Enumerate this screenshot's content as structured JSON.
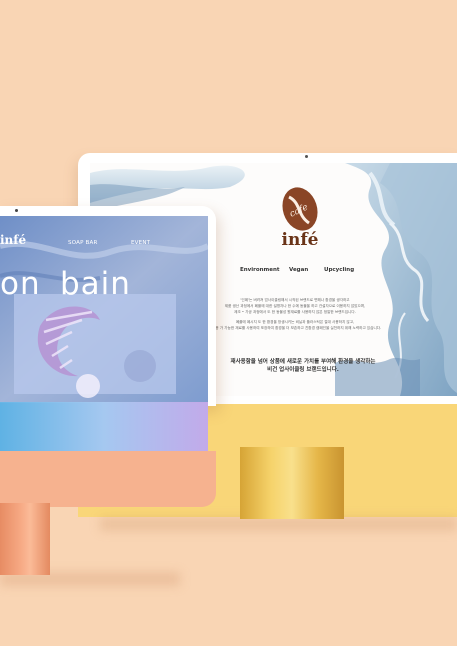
{
  "colors": {
    "background": "#f9d5b4",
    "back_chin": "#f9d678",
    "front_chin": "#f6b28f",
    "brand_brown": "#6a3418"
  },
  "back_site": {
    "logo_icon": "coffee-bean-logo-icon",
    "logo_text": "cafe",
    "brand_name": "infé",
    "nav": [
      "Environment",
      "Vegan",
      "Upcycling"
    ],
    "intro_lines": [
      "'인페'는 버려져 업사이클링해서 시작된 브랜드로 변해나 환경을 생각하고",
      "제품 생산 과정에서 폐플에 대한 설명자나 한 수에 동물을 하고 건설자으로 이용하지 않았으며,",
      "제조 • 가공 과정에서 도 한 동물성 원재료를 사용하지 않은 정말한 브랜드입니다.",
      "",
      "폐플에 페시지 도 한 환경을 망생시키는 비닐과 플라스틱은 절대 사용하지 않고,",
      "재활용 가 가능한 재료를 사용하여 포장하여 환경을 더 보존하고 친환경 캠페인을 실천하지 위해 노력하고 있습니다."
    ],
    "slogan_lines": [
      "재사용함을 넘어 상품에 새로운 가치를 부여해 환경을 생각하는",
      "비건 업사이클링 브랜드입니다."
    ]
  },
  "front_site": {
    "logo": "infé",
    "nav": [
      "SOAP BAR",
      "EVENT"
    ],
    "hero_words": [
      "on",
      "bain"
    ]
  }
}
